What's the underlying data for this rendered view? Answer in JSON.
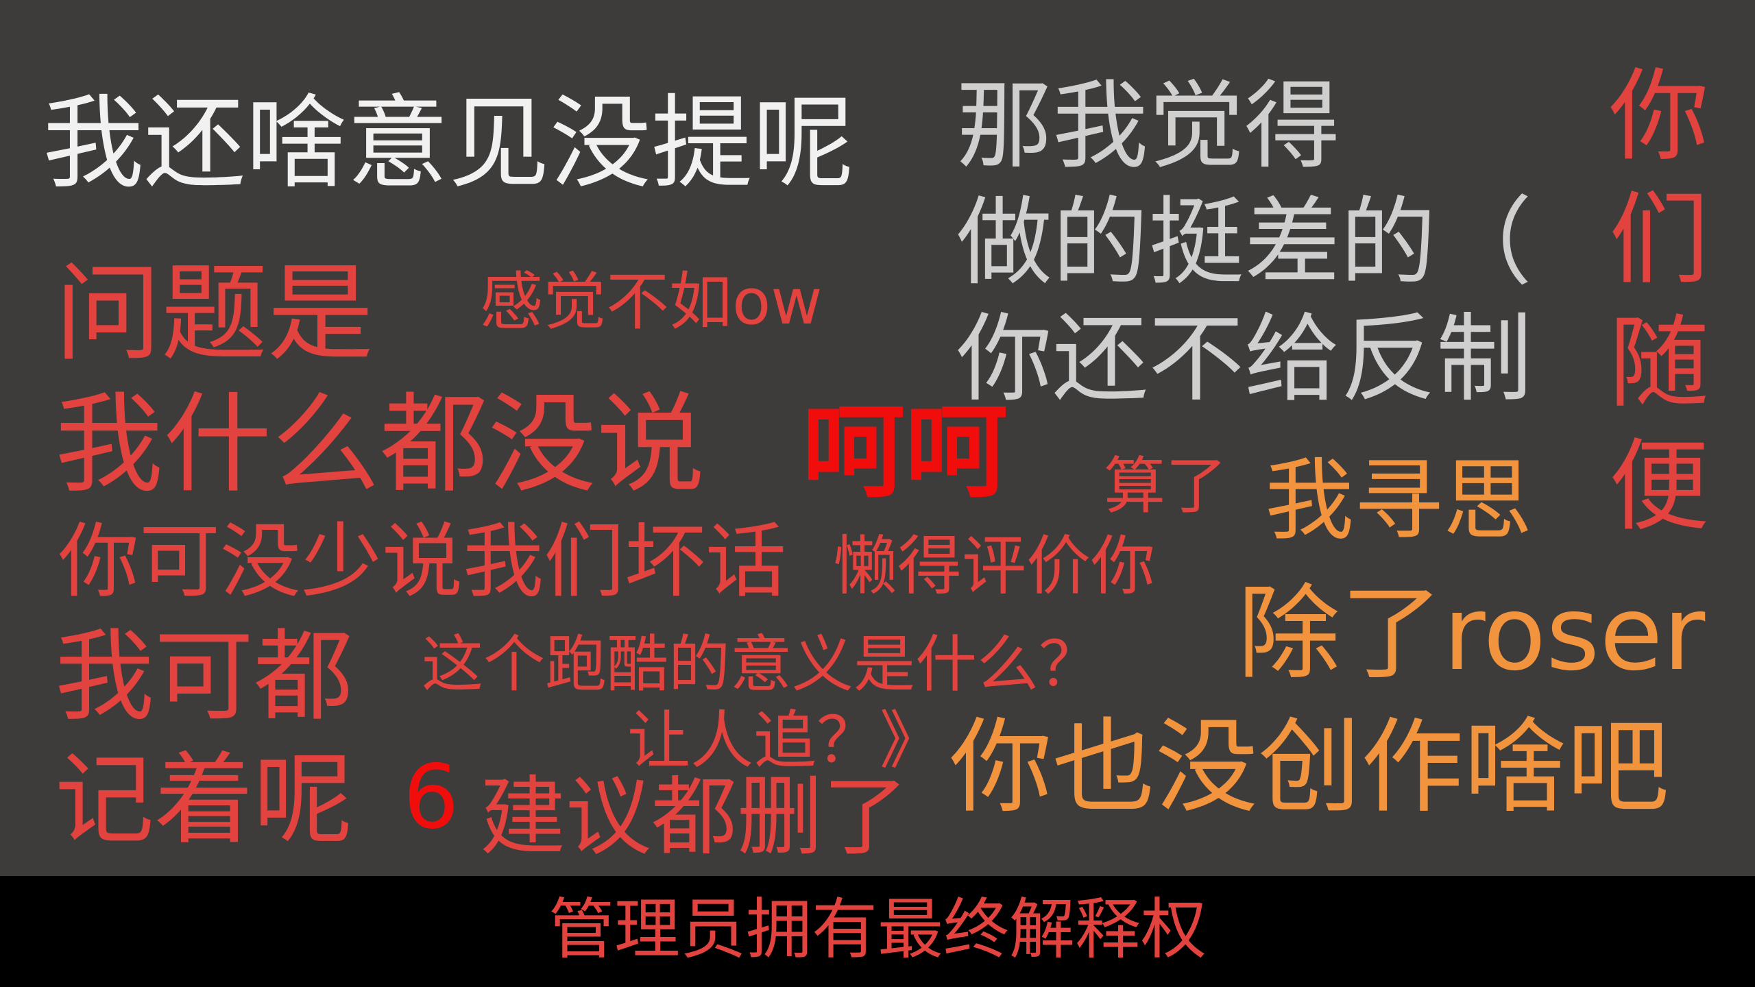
{
  "phrases": {
    "p1": "我还啥意见没提呢",
    "g1": "那我觉得\n做的挺差的（\n你还不给反制",
    "v1": "你\n们\n随\n便",
    "p2": "问题是",
    "p3": "感觉不如ow",
    "p4": "我什么都没说",
    "p5": "呵呵",
    "p6": "算了",
    "p7": "我寻思",
    "p8": "你可没少说我们坏话",
    "p9": "懒得评价你",
    "p10": "除了roser",
    "p11": "我可都",
    "p12": "这个跑酷的意义是什么？",
    "p13": "让人追？》",
    "p14": "记着呢",
    "p15": "6",
    "p16": "建议都删了",
    "p17": "你也没创作啥吧"
  },
  "footer": {
    "text": "管理员拥有最终解释权"
  },
  "colors": {
    "background": "#3e3c3b",
    "footer_background": "#000000",
    "white_text": "#f1f1f1",
    "gray_text": "#cfcfcf",
    "red_text": "#e3433e",
    "bright_red_text": "#f20d0d",
    "orange_text": "#f2933e"
  }
}
